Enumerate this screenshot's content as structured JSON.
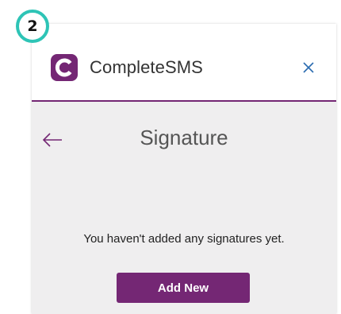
{
  "step": {
    "number": "2"
  },
  "header": {
    "app_name": "CompleteSMS",
    "logo_icon": "completesms-logo-icon",
    "close_icon": "close-icon"
  },
  "page": {
    "back_icon": "arrow-left-icon",
    "title": "Signature",
    "empty_message": "You haven't added any signatures yet.",
    "add_button_label": "Add New"
  },
  "colors": {
    "accent": "#742774",
    "badge_ring": "#2ec4b6",
    "body_background": "#efeeef"
  }
}
